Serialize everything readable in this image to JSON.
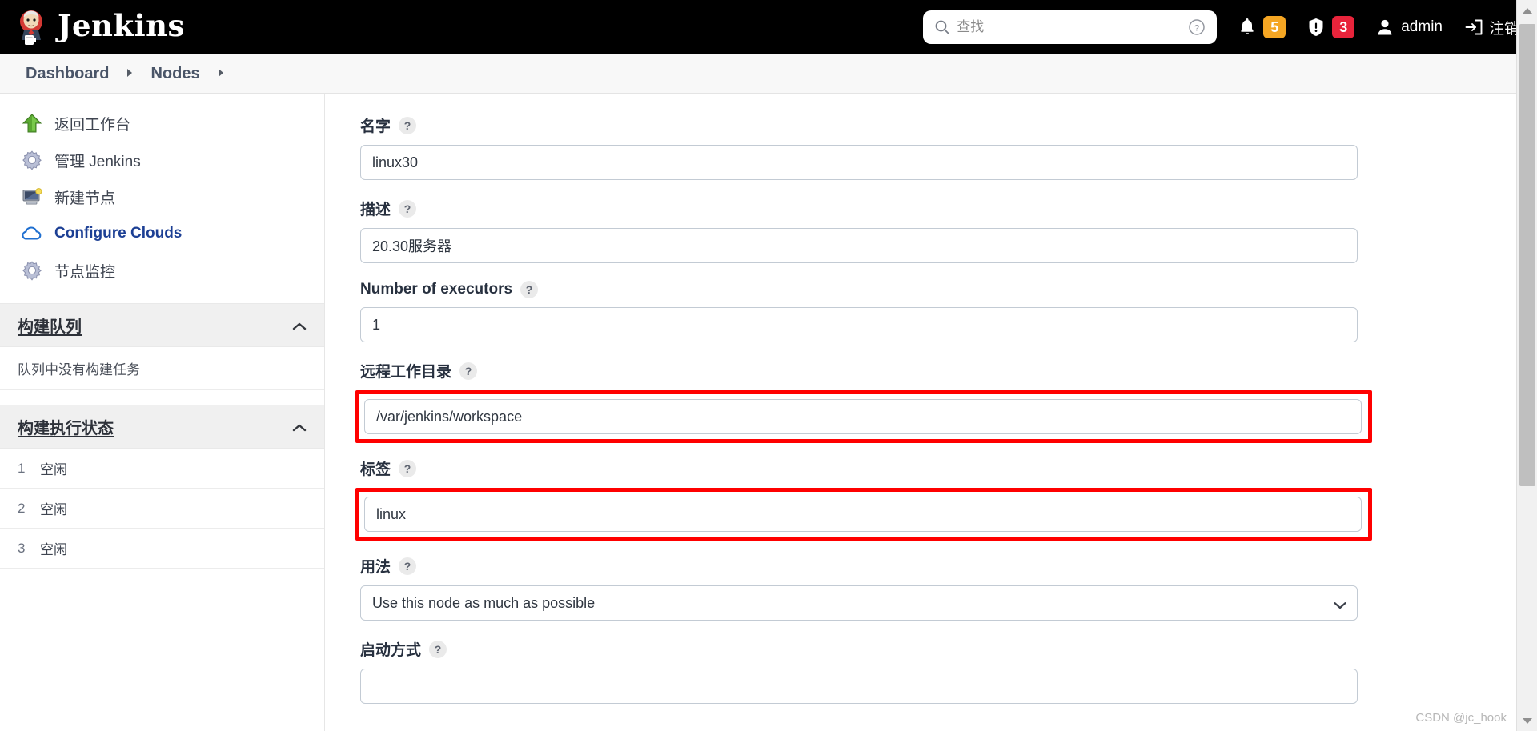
{
  "header": {
    "brand": "Jenkins",
    "brand_icon": "jenkins-butler-logo",
    "search": {
      "placeholder": "查找",
      "value": "",
      "icon": "search-icon",
      "help_icon": "question-circle-icon"
    },
    "notifications": {
      "icon": "bell-icon",
      "count": "5",
      "color": "#f5a623"
    },
    "security": {
      "icon": "shield-exclamation-icon",
      "count": "3",
      "color": "#e8243b"
    },
    "user": {
      "icon": "person-icon",
      "label": "admin"
    },
    "logout": {
      "icon": "logout-arrow-icon",
      "label": "注销"
    }
  },
  "breadcrumb": {
    "items": [
      {
        "label": "Dashboard"
      },
      {
        "label": "Nodes"
      }
    ],
    "separator": "▸"
  },
  "sidebar": {
    "links": [
      {
        "label": "返回工作台",
        "icon": "green-up-arrow-icon",
        "style": "plain"
      },
      {
        "label": "管理 Jenkins",
        "icon": "gear-icon",
        "style": "plain"
      },
      {
        "label": "新建节点",
        "icon": "computer-new-icon",
        "style": "plain"
      },
      {
        "label": "Configure Clouds",
        "icon": "cloud-icon",
        "style": "blue"
      },
      {
        "label": "节点监控",
        "icon": "gear-icon",
        "style": "plain"
      }
    ],
    "build_queue": {
      "title": "构建队列",
      "collapse_icon": "chevron-up-icon",
      "empty_message": "队列中没有构建任务"
    },
    "build_executor_status": {
      "title": "构建执行状态",
      "collapse_icon": "chevron-up-icon",
      "executors": [
        {
          "num": "1",
          "state": "空闲"
        },
        {
          "num": "2",
          "state": "空闲"
        },
        {
          "num": "3",
          "state": "空闲"
        }
      ]
    }
  },
  "form": {
    "help_glyph": "?",
    "fields": [
      {
        "label": "名字",
        "value": "linux30",
        "type": "text",
        "highlight": false
      },
      {
        "label": "描述",
        "value": "20.30服务器",
        "type": "text",
        "highlight": false
      },
      {
        "label": "Number of executors",
        "value": "1",
        "type": "text",
        "highlight": false
      },
      {
        "label": "远程工作目录",
        "value": "/var/jenkins/workspace",
        "type": "text",
        "highlight": true
      },
      {
        "label": "标签",
        "value": "linux",
        "type": "text",
        "highlight": true
      },
      {
        "label": "用法",
        "value": "Use this node as much as possible",
        "type": "select",
        "highlight": false,
        "caret_icon": "chevron-down-icon"
      },
      {
        "label": "启动方式",
        "value": "",
        "type": "select",
        "highlight": false,
        "caret_icon": "chevron-down-icon"
      }
    ]
  },
  "scrollbar": {
    "up_icon": "scroll-up-arrow-icon",
    "down_icon": "scroll-down-arrow-icon"
  },
  "watermark": "CSDN @jc_hook",
  "colors": {
    "header_bg": "#000000",
    "accent_blue": "#1c3f94",
    "highlight_red": "#ff0000",
    "badge_warn": "#f5a623",
    "badge_error": "#e8243b"
  }
}
